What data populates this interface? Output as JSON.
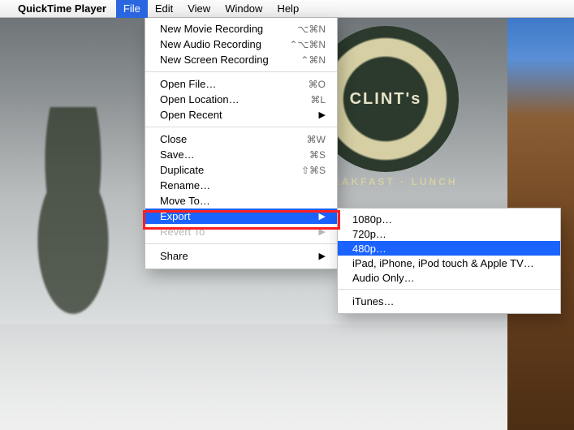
{
  "menubar": {
    "apple_icon": "",
    "app_name": "QuickTime Player",
    "items": [
      {
        "label": "File",
        "active": true
      },
      {
        "label": "Edit",
        "active": false
      },
      {
        "label": "View",
        "active": false
      },
      {
        "label": "Window",
        "active": false
      },
      {
        "label": "Help",
        "active": false
      }
    ]
  },
  "file_menu": {
    "groups": [
      [
        {
          "label": "New Movie Recording",
          "shortcut": "⌥⌘N",
          "submenu": false
        },
        {
          "label": "New Audio Recording",
          "shortcut": "⌃⌥⌘N",
          "submenu": false
        },
        {
          "label": "New Screen Recording",
          "shortcut": "⌃⌘N",
          "submenu": false
        }
      ],
      [
        {
          "label": "Open File…",
          "shortcut": "⌘O",
          "submenu": false
        },
        {
          "label": "Open Location…",
          "shortcut": "⌘L",
          "submenu": false
        },
        {
          "label": "Open Recent",
          "shortcut": "",
          "submenu": true
        }
      ],
      [
        {
          "label": "Close",
          "shortcut": "⌘W",
          "submenu": false
        },
        {
          "label": "Save…",
          "shortcut": "⌘S",
          "submenu": false
        },
        {
          "label": "Duplicate",
          "shortcut": "⇧⌘S",
          "submenu": false
        },
        {
          "label": "Rename…",
          "shortcut": "",
          "submenu": false
        },
        {
          "label": "Move To…",
          "shortcut": "",
          "submenu": false
        },
        {
          "label": "Export",
          "shortcut": "",
          "submenu": true,
          "highlight": true
        },
        {
          "label": "Revert To",
          "shortcut": "",
          "submenu": true,
          "disabled": true
        }
      ],
      [
        {
          "label": "Share",
          "shortcut": "",
          "submenu": true
        }
      ]
    ]
  },
  "export_submenu": {
    "groups": [
      [
        {
          "label": "1080p…"
        },
        {
          "label": "720p…"
        },
        {
          "label": "480p…",
          "highlight": true
        },
        {
          "label": "iPad, iPhone, iPod touch & Apple TV…"
        },
        {
          "label": "Audio Only…"
        }
      ],
      [
        {
          "label": "iTunes…"
        }
      ]
    ]
  },
  "background": {
    "sign_text_main": "CLINT's",
    "sign_text_sub": "BREAKFAST · LUNCH"
  },
  "colors": {
    "menu_highlight": "#1a63ff",
    "annotation_box": "#ff2020"
  }
}
